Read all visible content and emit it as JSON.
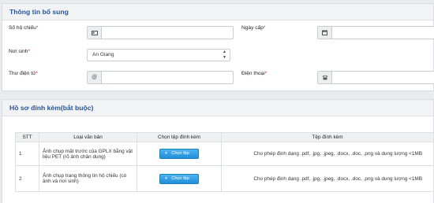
{
  "section1": {
    "title": "Thông tin bổ sung",
    "passport_label": "Số hộ chiếu",
    "issue_date_label": "Ngày cấp",
    "birthplace_label": "Nơi sinh",
    "birthplace_value": "An Giang",
    "email_label": "Thư điện tử",
    "phone_label": "Điện thoại",
    "required_mark": "*"
  },
  "section2": {
    "title": "Hồ sơ đính kèm(bắt buộc)",
    "columns": [
      "STT",
      "Loại văn bản",
      "Chọn tệp đính kèm",
      "Tệp đính kèm"
    ],
    "rows": [
      {
        "stt": "1",
        "doc_type": "Ảnh chụp mặt trước của GPLX bằng vật liệu PET (rõ ảnh chân dung)",
        "button": "Chọn tệp",
        "hint": "Cho phép định dạng .pdf, .jpg, .jpeg, .docx, .doc, .png và dung lượng <1MB"
      },
      {
        "stt": "2",
        "doc_type": "Ảnh chụp trang thông tin hộ chiếu (có ảnh và nơi sinh)",
        "button": "Chọn tệp",
        "hint": "Cho phép định dạng .pdf, .jpg, .jpeg, .docx, .doc, .png và dung lượng <1MB"
      }
    ]
  },
  "icons": {
    "passport": "id-card-icon",
    "date": "calendar-icon",
    "email": "at-sign-icon",
    "phone": "phone-icon"
  },
  "colors": {
    "header_text": "#2a5596",
    "required": "#c9302c",
    "button": "#1f8fd8"
  }
}
